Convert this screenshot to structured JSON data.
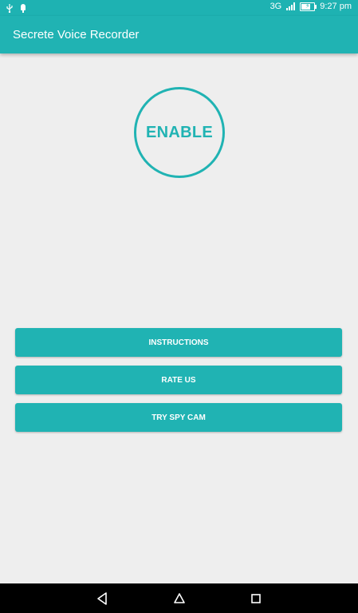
{
  "status_bar": {
    "network": "3G",
    "time": "9:27 pm",
    "icons": [
      "usb-icon",
      "android-debug-icon",
      "signal-icon",
      "battery-charging-icon"
    ]
  },
  "app_bar": {
    "title": "Secrete Voice Recorder"
  },
  "main": {
    "enable_label": "ENABLE",
    "buttons": [
      {
        "label": "INSTRUCTIONS"
      },
      {
        "label": "RATE US"
      },
      {
        "label": "TRY SPY CAM"
      }
    ]
  },
  "nav_bar": {
    "icons": [
      "back-icon",
      "home-icon",
      "recents-icon"
    ]
  },
  "colors": {
    "primary": "#20b3b3",
    "background": "#eeeeee",
    "nav_bar": "#000000"
  }
}
